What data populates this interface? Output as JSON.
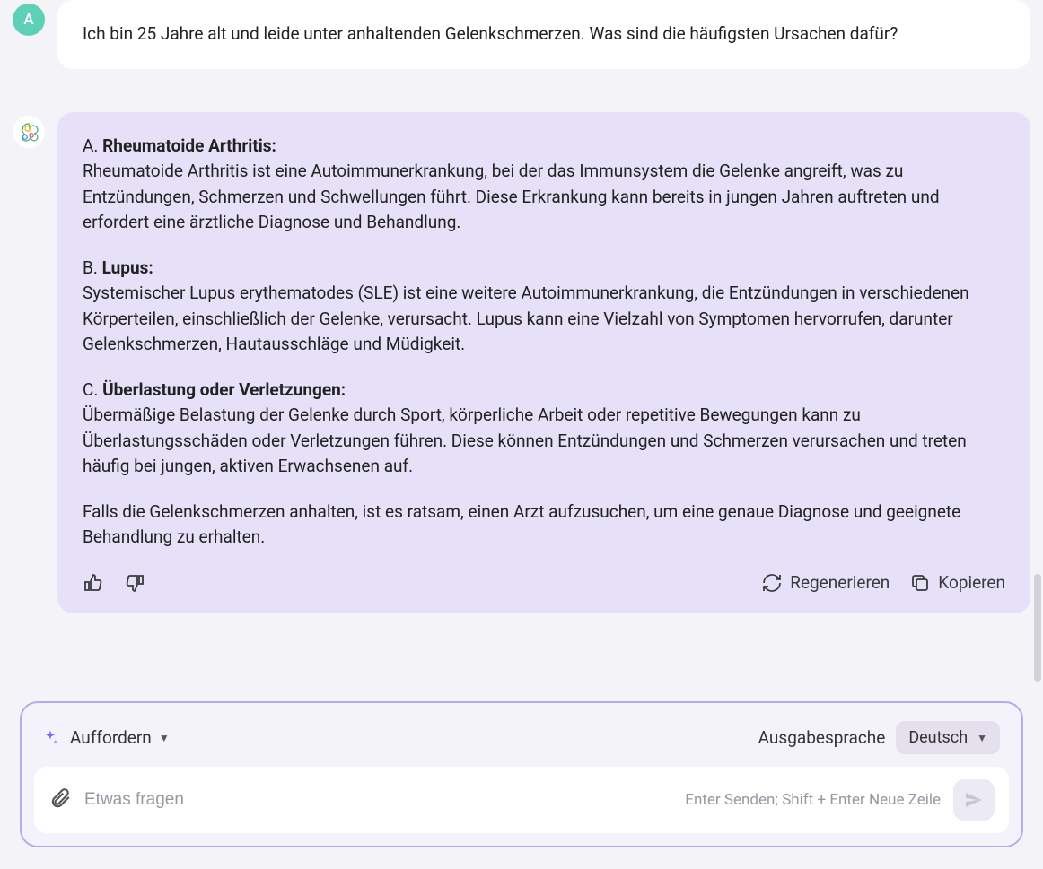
{
  "user": {
    "avatar_letter": "A",
    "message": "Ich bin 25 Jahre alt und leide unter anhaltenden Gelenkschmerzen. Was sind die häufigsten Ursachen dafür?"
  },
  "ai": {
    "sections": [
      {
        "label": "A. ",
        "title": "Rheumatoide Arthritis:",
        "body": "Rheumatoide Arthritis ist eine Autoimmunerkrankung, bei der das Immunsystem die Gelenke angreift, was zu Entzündungen, Schmerzen und Schwellungen führt. Diese Erkrankung kann bereits in jungen Jahren auftreten und erfordert eine ärztliche Diagnose und Behandlung."
      },
      {
        "label": "B. ",
        "title": "Lupus:",
        "body": "Systemischer Lupus erythematodes (SLE) ist eine weitere Autoimmunerkrankung, die Entzündungen in verschiedenen Körperteilen, einschließlich der Gelenke, verursacht. Lupus kann eine Vielzahl von Symptomen hervorrufen, darunter Gelenkschmerzen, Hautausschläge und Müdigkeit."
      },
      {
        "label": "C. ",
        "title": "Überlastung oder Verletzungen:",
        "body": "Übermäßige Belastung der Gelenke durch Sport, körperliche Arbeit oder repetitive Bewegungen kann zu Überlastungsschäden oder Verletzungen führen. Diese können Entzündungen und Schmerzen verursachen und treten häufig bei jungen, aktiven Erwachsenen auf."
      }
    ],
    "closing": "Falls die Gelenkschmerzen anhalten, ist es ratsam, einen Arzt aufzusuchen, um eine genaue Diagnose und geeignete Behandlung zu erhalten."
  },
  "actions": {
    "regenerate": "Regenerieren",
    "copy": "Kopieren"
  },
  "composer": {
    "mode_label": "Auffordern",
    "output_lang_label": "Ausgabesprache",
    "selected_lang": "Deutsch",
    "placeholder": "Etwas fragen",
    "hint": "Enter Senden; Shift + Enter Neue Zeile"
  }
}
